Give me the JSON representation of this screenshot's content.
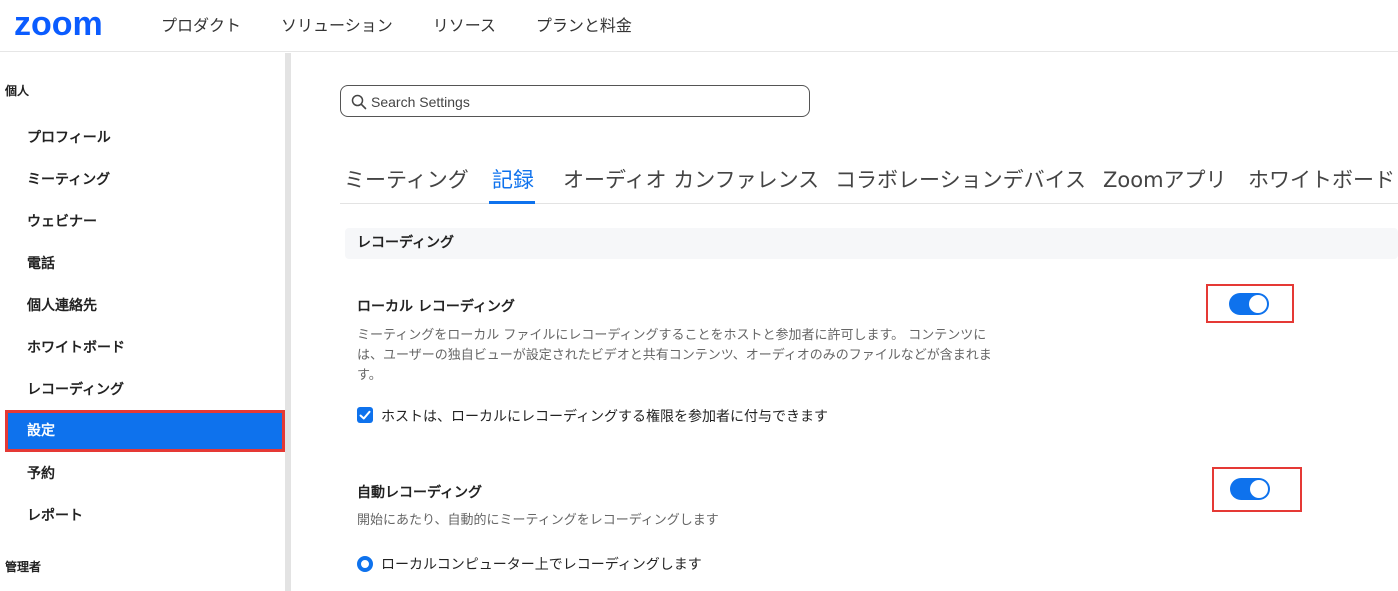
{
  "header": {
    "logo": "zoom",
    "nav": [
      "プロダクト",
      "ソリューション",
      "リソース",
      "プランと料金"
    ]
  },
  "sidebar": {
    "personal_heading": "個人",
    "items": [
      {
        "label": "プロフィール"
      },
      {
        "label": "ミーティング"
      },
      {
        "label": "ウェビナー"
      },
      {
        "label": "電話"
      },
      {
        "label": "個人連絡先"
      },
      {
        "label": "ホワイトボード"
      },
      {
        "label": "レコーディング"
      },
      {
        "label": "設定",
        "active": true
      },
      {
        "label": "予約"
      },
      {
        "label": "レポート"
      }
    ],
    "admin_heading": "管理者"
  },
  "search": {
    "placeholder": "Search Settings"
  },
  "tabs": [
    {
      "label": "ミーティング"
    },
    {
      "label": "記録",
      "active": true
    },
    {
      "label": "オーディオ カンファレンス"
    },
    {
      "label": "コラボレーションデバイス"
    },
    {
      "label": "Zoomアプリ"
    },
    {
      "label": "ホワイトボード"
    }
  ],
  "section": {
    "heading": "レコーディング"
  },
  "settings": {
    "local_recording": {
      "title": "ローカル レコーディング",
      "desc_line1": "ミーティングをローカル ファイルにレコーディングすることをホストと参加者に許可します。 コンテンツに",
      "desc_line2": "は、ユーザーの独自ビューが設定されたビデオと共有コンテンツ、オーディオのみのファイルなどが含まれま",
      "desc_line3": "す。",
      "enabled": true,
      "option_label": "ホストは、ローカルにレコーディングする権限を参加者に付与できます",
      "option_checked": true
    },
    "auto_recording": {
      "title": "自動レコーディング",
      "desc": "開始にあたり、自動的にミーティングをレコーディングします",
      "enabled": true,
      "option_label": "ローカルコンピューター上でレコーディングします",
      "option_selected": true
    }
  },
  "colors": {
    "brand": "#0b5cff",
    "accent": "#0e72ed",
    "highlight_border": "#e53935"
  }
}
